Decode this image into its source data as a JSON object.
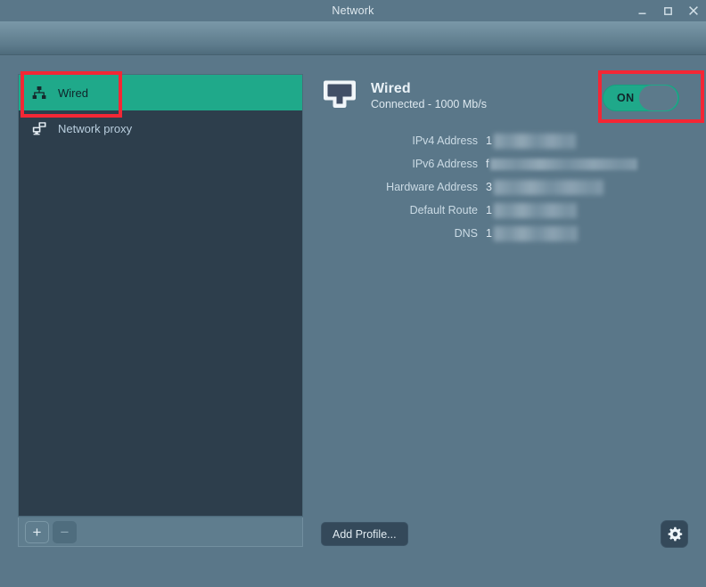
{
  "window": {
    "title": "Network",
    "controls": [
      {
        "name": "minimize-button",
        "glyph": "minimize"
      },
      {
        "name": "maximize-button",
        "glyph": "maximize"
      },
      {
        "name": "close-button",
        "glyph": "close"
      }
    ]
  },
  "sidebar": {
    "items": [
      {
        "label": "Wired",
        "icon": "network-wired-icon",
        "selected": true
      },
      {
        "label": "Network proxy",
        "icon": "network-proxy-icon",
        "selected": false
      }
    ],
    "toolbar": {
      "add_label": "+",
      "remove_label": "−"
    }
  },
  "details": {
    "device_icon": "ethernet-port-icon",
    "title": "Wired",
    "subtitle": "Connected - 1000 Mb/s",
    "toggle": {
      "label": "ON",
      "state": "on",
      "accent_color": "#1fa98a"
    },
    "info_rows": [
      {
        "label": "IPv4 Address",
        "value_prefix": "1",
        "redacted_width": 92,
        "redacted": true
      },
      {
        "label": "IPv6 Address",
        "value_prefix": "f",
        "redacted_width": 165,
        "redacted": true
      },
      {
        "label": "Hardware Address",
        "value_prefix": "3",
        "redacted_width": 123,
        "redacted": true
      },
      {
        "label": "Default Route",
        "value_prefix": "1",
        "redacted_width": 93,
        "redacted": true
      },
      {
        "label": "DNS",
        "value_prefix": "1",
        "redacted_width": 94,
        "redacted": true
      }
    ]
  },
  "footer": {
    "add_profile_label": "Add Profile...",
    "settings_icon": "gear-icon"
  },
  "annotations": [
    {
      "name": "annotation-wired",
      "color": "#f32735"
    },
    {
      "name": "annotation-toggle",
      "color": "#f32735"
    }
  ],
  "colors": {
    "background": "#5a7789",
    "sidebar_bg": "#2d3e4c",
    "accent": "#1fa98a",
    "annotation": "#f32735"
  }
}
